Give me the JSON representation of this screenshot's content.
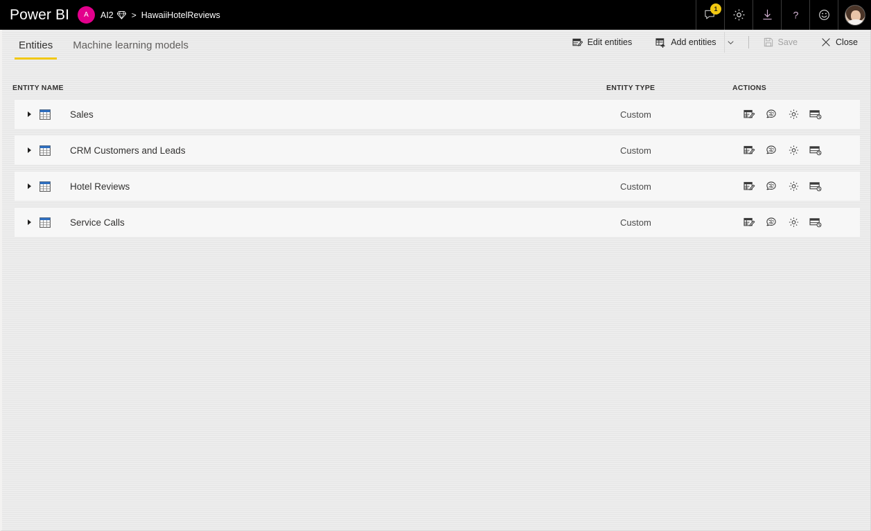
{
  "topbar": {
    "brand": "Power BI",
    "workspace_avatar_letter": "A",
    "workspace_name": "AI2",
    "premium_icon": "diamond-icon",
    "breadcrumb_separator": ">",
    "dataflow_name": "HawaiiHotelReviews",
    "actions": [
      {
        "name": "notifications-button",
        "icon": "notification-bell-icon",
        "badge": "1"
      },
      {
        "name": "settings-button",
        "icon": "gear-icon"
      },
      {
        "name": "downloads-button",
        "icon": "download-icon"
      },
      {
        "name": "help-button",
        "icon": "question-mark-icon"
      },
      {
        "name": "feedback-button",
        "icon": "smiley-face-icon"
      },
      {
        "name": "account-button",
        "icon": "user-avatar-icon"
      }
    ],
    "colors": {
      "background": "#000000",
      "avatar": "#e3008c",
      "badge": "#f2c811"
    }
  },
  "toolbar": {
    "edit_entities_label": "Edit entities",
    "edit_entities_icon": "edit-table-icon",
    "add_entities_label": "Add entities",
    "add_entities_icon": "add-table-icon",
    "add_entities_chevron_icon": "chevron-down-icon",
    "save_label": "Save",
    "save_icon": "save-disk-icon",
    "save_disabled": true,
    "close_label": "Close",
    "close_icon": "close-x-icon"
  },
  "tabs": {
    "active_index": 0,
    "accent_color": "#f2c811",
    "items": [
      {
        "label": "Entities",
        "name": "tab-entities"
      },
      {
        "label": "Machine learning models",
        "name": "tab-machine-learning-models"
      }
    ]
  },
  "list": {
    "columns": {
      "name": "ENTITY NAME",
      "type": "ENTITY TYPE",
      "actions": "ACTIONS"
    },
    "row_action_icons": [
      "edit-entity-icon",
      "apply-ml-model-icon",
      "entity-settings-icon",
      "incremental-refresh-icon"
    ],
    "rows": [
      {
        "name": "Sales",
        "type": "Custom",
        "expand_icon": "chevron-right-icon",
        "entity_icon": "table-icon"
      },
      {
        "name": "CRM Customers and Leads",
        "type": "Custom",
        "expand_icon": "chevron-right-icon",
        "entity_icon": "table-icon"
      },
      {
        "name": "Hotel Reviews",
        "type": "Custom",
        "expand_icon": "chevron-right-icon",
        "entity_icon": "table-icon"
      },
      {
        "name": "Service Calls",
        "type": "Custom",
        "expand_icon": "chevron-right-icon",
        "entity_icon": "table-icon"
      }
    ]
  }
}
